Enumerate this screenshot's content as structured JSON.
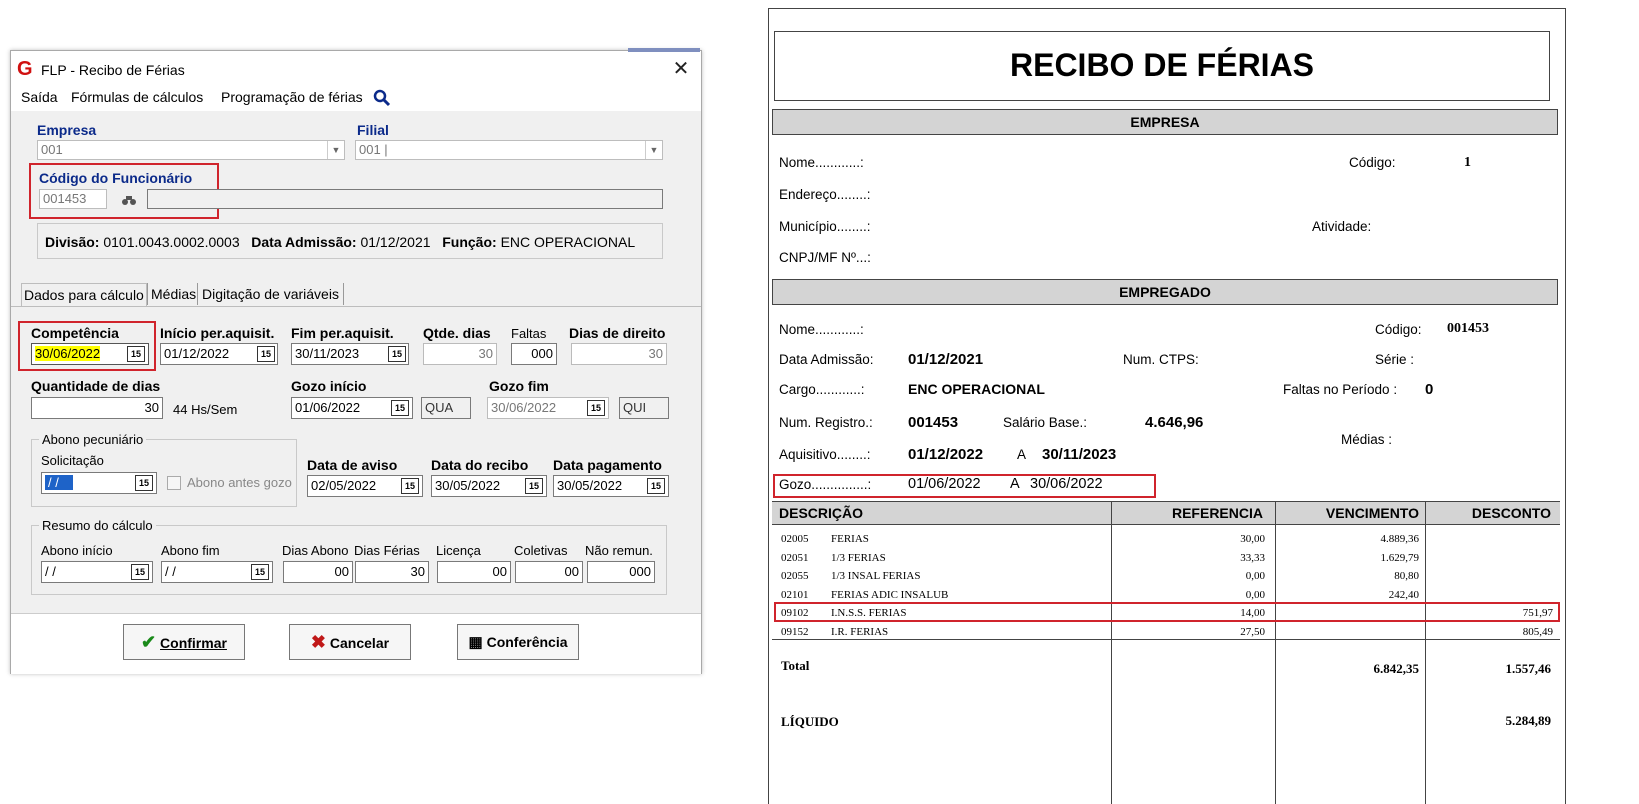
{
  "dialog": {
    "logo": "G",
    "title": "FLP - Recibo de Férias",
    "close": "✕",
    "menu": [
      "Saída",
      "Fórmulas de cálculos",
      "Programação de férias"
    ],
    "empresa_label": "Empresa",
    "empresa_value": "001",
    "filial_label": "Filial",
    "filial_value": "001 |",
    "codigo_label": "Código do Funcionário",
    "codigo_value": "001453",
    "info": {
      "divisao_label": "Divisão:",
      "divisao_value": "0101.0043.0002.0003",
      "admissao_label": "Data Admissão:",
      "admissao_value": "01/12/2021",
      "funcao_label": "Função:",
      "funcao_value": "ENC OPERACIONAL"
    },
    "tabs": [
      "Dados para cálculo",
      "Médias",
      "Digitação de variáveis"
    ],
    "fields": {
      "competencia_label": "Competência",
      "competencia_value": "30/06/2022",
      "inicio_label": "Início per.aquisit.",
      "inicio_value": "01/12/2022",
      "fim_label": "Fim per.aquisit.",
      "fim_value": "30/11/2023",
      "qtde_label": "Qtde. dias",
      "qtde_value": "30",
      "faltas_label": "Faltas",
      "faltas_value": "000",
      "direito_label": "Dias de direito",
      "direito_value": "30",
      "quantidade_label": "Quantidade de dias",
      "quantidade_value": "30",
      "hs_sem": "44 Hs/Sem",
      "gozo_inicio_label": "Gozo início",
      "gozo_inicio_value": "01/06/2022",
      "gozo_inicio_dow": "QUA",
      "gozo_fim_label": "Gozo fim",
      "gozo_fim_value": "30/06/2022",
      "gozo_fim_dow": "QUI",
      "abono_group": "Abono pecuniário",
      "solicitacao_label": "Solicitação",
      "solicitacao_value": "/ /",
      "abono_antes": "Abono antes gozo",
      "aviso_label": "Data de aviso",
      "aviso_value": "02/05/2022",
      "recibo_label": "Data do recibo",
      "recibo_value": "30/05/2022",
      "pagamento_label": "Data pagamento",
      "pagamento_value": "30/05/2022",
      "resumo_group": "Resumo do cálculo",
      "abono_inicio_label": "Abono início",
      "abono_inicio_value": "/ /",
      "abono_fim_label": "Abono fim",
      "abono_fim_value": "/ /",
      "dias_abono_label": "Dias Abono",
      "dias_abono_value": "00",
      "dias_ferias_label": "Dias Férias",
      "dias_ferias_value": "30",
      "licenca_label": "Licença",
      "licenca_value": "00",
      "coletivas_label": "Coletivas",
      "coletivas_value": "00",
      "nao_remun_label": "Não remun.",
      "nao_remun_value": "000"
    },
    "cal_icon": "15",
    "buttons": {
      "confirmar": "Confirmar",
      "cancelar": "Cancelar",
      "conferencia": "Conferência"
    }
  },
  "receipt": {
    "title": "RECIBO DE FÉRIAS",
    "empresa_band": "EMPRESA",
    "empresa": {
      "nome": "Nome............:",
      "codigo_label": "Código:",
      "codigo_value": "1",
      "endereco": "Endereço........:",
      "municipio": "Município........:",
      "atividade": "Atividade:",
      "cnpj": "CNPJ/MF Nº...:"
    },
    "empregado_band": "EMPREGADO",
    "empregado": {
      "nome": "Nome............:",
      "codigo_label": "Código:",
      "codigo_value": "001453",
      "admissao_label": "Data Admissão:",
      "admissao_value": "01/12/2021",
      "ctps_label": "Num. CTPS:",
      "serie_label": "Série :",
      "cargo_label": "Cargo............:",
      "cargo_value": "ENC OPERACIONAL",
      "faltas_label": "Faltas no Período :",
      "faltas_value": "0",
      "registro_label": "Num. Registro.:",
      "registro_value": "001453",
      "salario_label": "Salário Base.:",
      "salario_value": "4.646,96",
      "aquisitivo_label": "Aquisitivo........:",
      "aquisitivo_inicio": "01/12/2022",
      "aquisitivo_a": "A",
      "aquisitivo_fim": "30/11/2023",
      "medias_label": "Médias :",
      "gozo_label": "Gozo...............:",
      "gozo_inicio": "01/06/2022",
      "gozo_a": "A",
      "gozo_fim": "30/06/2022"
    },
    "table": {
      "headers": [
        "DESCRIÇÃO",
        "REFERENCIA",
        "VENCIMENTO",
        "DESCONTO"
      ],
      "rows": [
        {
          "code": "02005",
          "desc": "FERIAS",
          "ref": "30,00",
          "venc": "4.889,36",
          "desc_val": ""
        },
        {
          "code": "02051",
          "desc": "1/3 FERIAS",
          "ref": "33,33",
          "venc": "1.629,79",
          "desc_val": ""
        },
        {
          "code": "02055",
          "desc": "1/3 INSAL FERIAS",
          "ref": "0,00",
          "venc": "80,80",
          "desc_val": ""
        },
        {
          "code": "02101",
          "desc": "FERIAS ADIC INSALUB",
          "ref": "0,00",
          "venc": "242,40",
          "desc_val": ""
        },
        {
          "code": "09102",
          "desc": "I.N.S.S. FERIAS",
          "ref": "14,00",
          "venc": "",
          "desc_val": "751,97"
        },
        {
          "code": "09152",
          "desc": "I.R. FERIAS",
          "ref": "27,50",
          "venc": "",
          "desc_val": "805,49"
        }
      ],
      "total_label": "Total",
      "total_venc": "6.842,35",
      "total_desc": "1.557,46",
      "liquido_label": "LÍQUIDO",
      "liquido_value": "5.284,89"
    }
  }
}
